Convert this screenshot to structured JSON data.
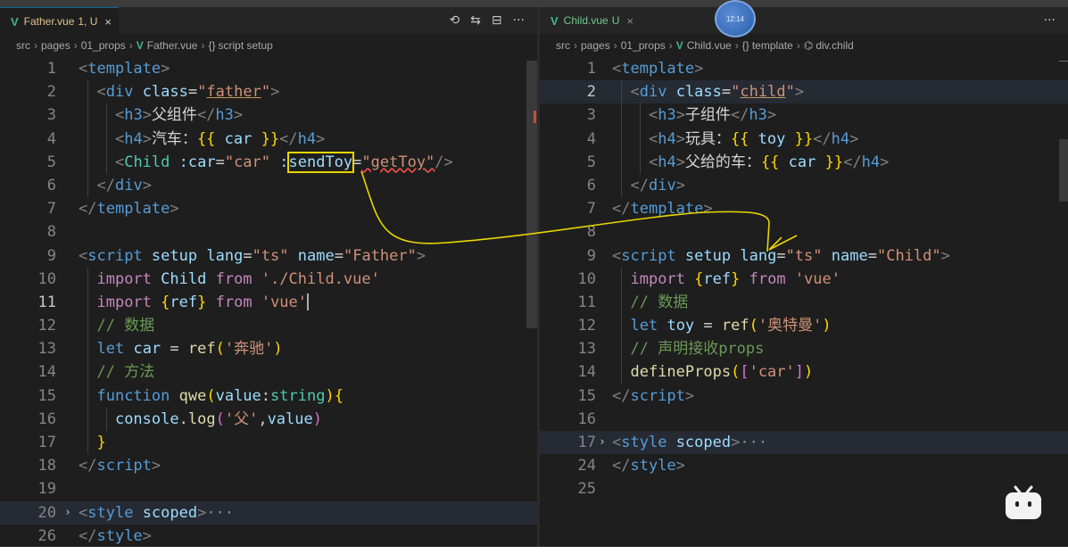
{
  "left": {
    "tab": {
      "vue": "V",
      "name": "Father.vue",
      "status": "1, U",
      "close": "×"
    },
    "actions": [
      "⟲",
      "⇆",
      "⊟",
      "···"
    ],
    "breadcrumb": {
      "seg1": "src",
      "seg2": "pages",
      "seg3": "01_props",
      "file": "Father.vue",
      "braces": "{}",
      "symbol": "script setup"
    },
    "line_numbers": [
      "1",
      "2",
      "3",
      "4",
      "5",
      "6",
      "7",
      "8",
      "9",
      "10",
      "11",
      "12",
      "13",
      "14",
      "15",
      "16",
      "17",
      "18",
      "19",
      "20",
      "26"
    ],
    "code": {
      "l1": "template",
      "l2_tag": "div",
      "l2_attr": "class",
      "l2_val": "father",
      "l3_tag": "h3",
      "l3_text": "父组件",
      "l4_tag": "h4",
      "l4_text": "汽车：",
      "l4_expr": "car",
      "l5_tag": "Child",
      "l5_attr1": " :car",
      "l5_val1": "\"car\"",
      "l5_colon": " :",
      "l5_attr2": "sendToy",
      "l5_val2": "\"getToy\"",
      "l6_tag": "div",
      "l7_tag": "template",
      "l9_tag": "script",
      "l9_a1": "setup",
      "l9_a2": "lang",
      "l9_v2": "\"ts\"",
      "l9_a3": "name",
      "l9_v3": "\"Father\"",
      "l10_kw": "import",
      "l10_name": "Child",
      "l10_from": "from",
      "l10_path": "'./Child.vue'",
      "l11_kw": "import",
      "l11_name": "ref",
      "l11_from": "from",
      "l11_path": "'vue'",
      "l12": "// 数据",
      "l13_kw": "let",
      "l13_var": "car",
      "l13_fn": "ref",
      "l13_str": "'奔驰'",
      "l14": "// 方法",
      "l15_kw": "function",
      "l15_fn": "qwe",
      "l15_param": "value",
      "l15_type": "string",
      "l16_obj": "console",
      "l16_fn": "log",
      "l16_str": "'父'",
      "l16_arg": "value",
      "l18_tag": "script",
      "l20_tag": "style",
      "l20_attr": "scoped",
      "l20_more": "···",
      "l26_tag": "style"
    }
  },
  "right": {
    "tab": {
      "vue": "V",
      "name": "Child.vue",
      "status": "U",
      "close": "×"
    },
    "more": "···",
    "avatar_text": "12:14",
    "breadcrumb": {
      "seg1": "src",
      "seg2": "pages",
      "seg3": "01_props",
      "file": "Child.vue",
      "braces": "{}",
      "symbol1": "template",
      "symbol2": "div.child"
    },
    "line_numbers": [
      "1",
      "2",
      "3",
      "4",
      "5",
      "6",
      "7",
      "8",
      "9",
      "10",
      "11",
      "12",
      "13",
      "14",
      "15",
      "16",
      "17",
      "24",
      "25"
    ],
    "code": {
      "l1": "template",
      "l2_tag": "div",
      "l2_attr": "class",
      "l2_val": "child",
      "l3_tag": "h3",
      "l3_text": "子组件",
      "l4_tag": "h4",
      "l4_text": "玩具：",
      "l4_expr": "toy",
      "l5_tag": "h4",
      "l5_text": "父给的车：",
      "l5_expr": "car",
      "l6_tag": "div",
      "l7_tag": "template",
      "l9_tag": "script",
      "l9_a1": "setup",
      "l9_a2": "lang",
      "l9_v2": "\"ts\"",
      "l9_a3": "name",
      "l9_v3": "\"Child\"",
      "l10_kw": "import",
      "l10_name": "ref",
      "l10_from": "from",
      "l10_path": "'vue'",
      "l11": "// 数据",
      "l12_kw": "let",
      "l12_var": "toy",
      "l12_fn": "ref",
      "l12_str": "'奥特曼'",
      "l13": "// 声明接收props",
      "l14_fn": "defineProps",
      "l14_str": "'car'",
      "l15_tag": "script",
      "l17_tag": "style",
      "l17_attr": "scoped",
      "l17_more": "···",
      "l24_tag": "style"
    }
  },
  "colors": {
    "annotation": "#e8d600",
    "vue_green": "#41b883",
    "modified": "#e2c08d",
    "untracked": "#73c991"
  },
  "icons": {
    "fold": "chevron-right-icon",
    "vue": "vue-file-icon",
    "logo": "bilibili-tv-icon"
  }
}
